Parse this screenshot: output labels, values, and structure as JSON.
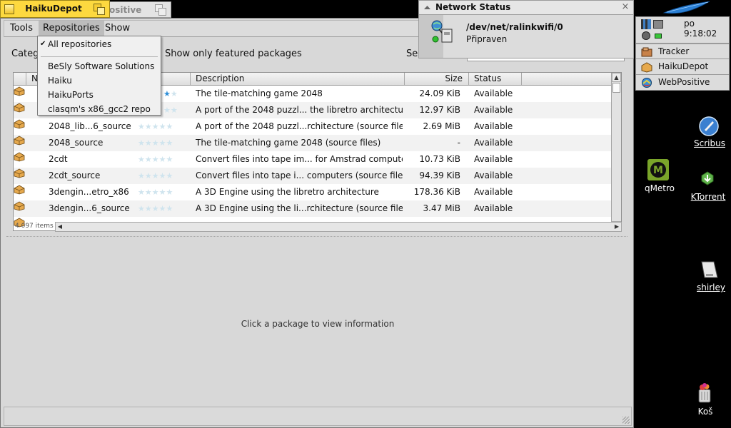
{
  "tabs": {
    "main": "HaikuDepot",
    "background": "ositive"
  },
  "menubar": {
    "tools": "Tools",
    "repositories": "Repositories",
    "show": "Show"
  },
  "filter": {
    "category_label": "Catego",
    "featured_label": "Show only featured packages",
    "search_label": "Sea"
  },
  "repositories_menu": {
    "all": "All repositories",
    "items": [
      "BeSly Software Solutions",
      "Haiku",
      "HaikuPorts",
      "clasqm's x86_gcc2 repo"
    ]
  },
  "table": {
    "columns": {
      "name": "Na",
      "description": "Description",
      "size": "Size",
      "status": "Status"
    },
    "rows": [
      {
        "name": "",
        "rating": "★★",
        "description": "The tile-matching game 2048",
        "size": "24.09 KiB",
        "status": "Available"
      },
      {
        "name": "",
        "rating": "★★",
        "description": "A port of the 2048 puzzl... the libretro architecture",
        "size": "12.97 KiB",
        "status": "Available"
      },
      {
        "name": "2048_lib...6_source",
        "rating": "★★★★★",
        "description": "A port of the 2048 puzzl...rchitecture (source files)",
        "size": "2.69 MiB",
        "status": "Available"
      },
      {
        "name": "2048_source",
        "rating": "★★★★★",
        "description": "The tile-matching game 2048 (source files)",
        "size": "-",
        "status": "Available"
      },
      {
        "name": "2cdt",
        "rating": "★★★★★",
        "description": "Convert files into tape im... for Amstrad computers",
        "size": "10.73 KiB",
        "status": "Available"
      },
      {
        "name": "2cdt_source",
        "rating": "★★★★★",
        "description": "Convert files into tape i... computers (source files)",
        "size": "94.39 KiB",
        "status": "Available"
      },
      {
        "name": "3dengin...etro_x86",
        "rating": "★★★★★",
        "description": "A 3D Engine using the libretro architecture",
        "size": "178.36 KiB",
        "status": "Available"
      },
      {
        "name": "3dengin...6_source",
        "rating": "★★★★★",
        "description": "A 3D Engine using the li...rchitecture (source files)",
        "size": "3.47 MiB",
        "status": "Available"
      }
    ],
    "item_count": "4 097 items"
  },
  "info": {
    "placeholder": "Click a package to view information"
  },
  "network_status": {
    "title": "Network Status",
    "interface": "/dev/net/ralinkwifi/0",
    "state": "Připraven"
  },
  "deskbar": {
    "clock": "po 9:18:02",
    "apps": [
      {
        "label": "Tracker",
        "icon": "tracker-icon"
      },
      {
        "label": "HaikuDepot",
        "icon": "haikudepot-icon"
      },
      {
        "label": "WebPositive",
        "icon": "webpositive-icon"
      }
    ]
  },
  "desktop_icons": {
    "scribus": "Scribus",
    "qmetro": "qMetro",
    "ktorrent": "KTorrent",
    "shirley": "shirley",
    "trash": "Koš"
  },
  "colors": {
    "active_tab": "#fdd93f",
    "window_bg": "#d8d8d8",
    "desktop": "#000000",
    "rating_star_active": "#2f8fd8",
    "rating_star_inactive": "#cfe4ee"
  }
}
